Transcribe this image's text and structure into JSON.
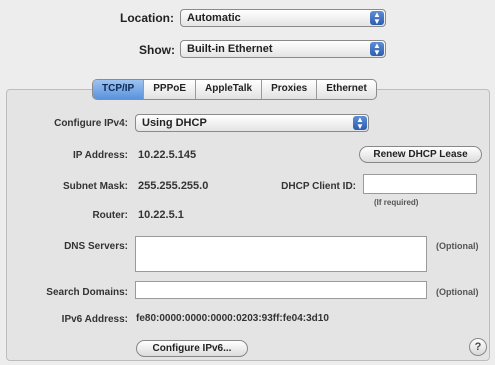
{
  "location": {
    "label": "Location:",
    "value": "Automatic"
  },
  "show": {
    "label": "Show:",
    "value": "Built-in Ethernet"
  },
  "tabs": [
    {
      "label": "TCP/IP",
      "active": true
    },
    {
      "label": "PPPoE",
      "active": false
    },
    {
      "label": "AppleTalk",
      "active": false
    },
    {
      "label": "Proxies",
      "active": false
    },
    {
      "label": "Ethernet",
      "active": false
    }
  ],
  "configure_ipv4": {
    "label": "Configure IPv4:",
    "value": "Using DHCP"
  },
  "ip_address": {
    "label": "IP Address:",
    "value": "10.22.5.145"
  },
  "renew_button": "Renew DHCP Lease",
  "subnet_mask": {
    "label": "Subnet Mask:",
    "value": "255.255.255.0"
  },
  "dhcp_client_id": {
    "label": "DHCP Client ID:",
    "value": "",
    "hint": "(If required)"
  },
  "router": {
    "label": "Router:",
    "value": "10.22.5.1"
  },
  "dns_servers": {
    "label": "DNS Servers:",
    "value": "",
    "hint": "(Optional)"
  },
  "search_domains": {
    "label": "Search Domains:",
    "value": "",
    "hint": "(Optional)"
  },
  "ipv6_address": {
    "label": "IPv6 Address:",
    "value": "fe80:0000:0000:0000:0203:93ff:fe04:3d10"
  },
  "configure_ipv6_button": "Configure IPv6...",
  "help_button": "?",
  "colors": {
    "accent": "#5a92dd",
    "panel": "#e4e4e4",
    "window": "#ededed"
  }
}
